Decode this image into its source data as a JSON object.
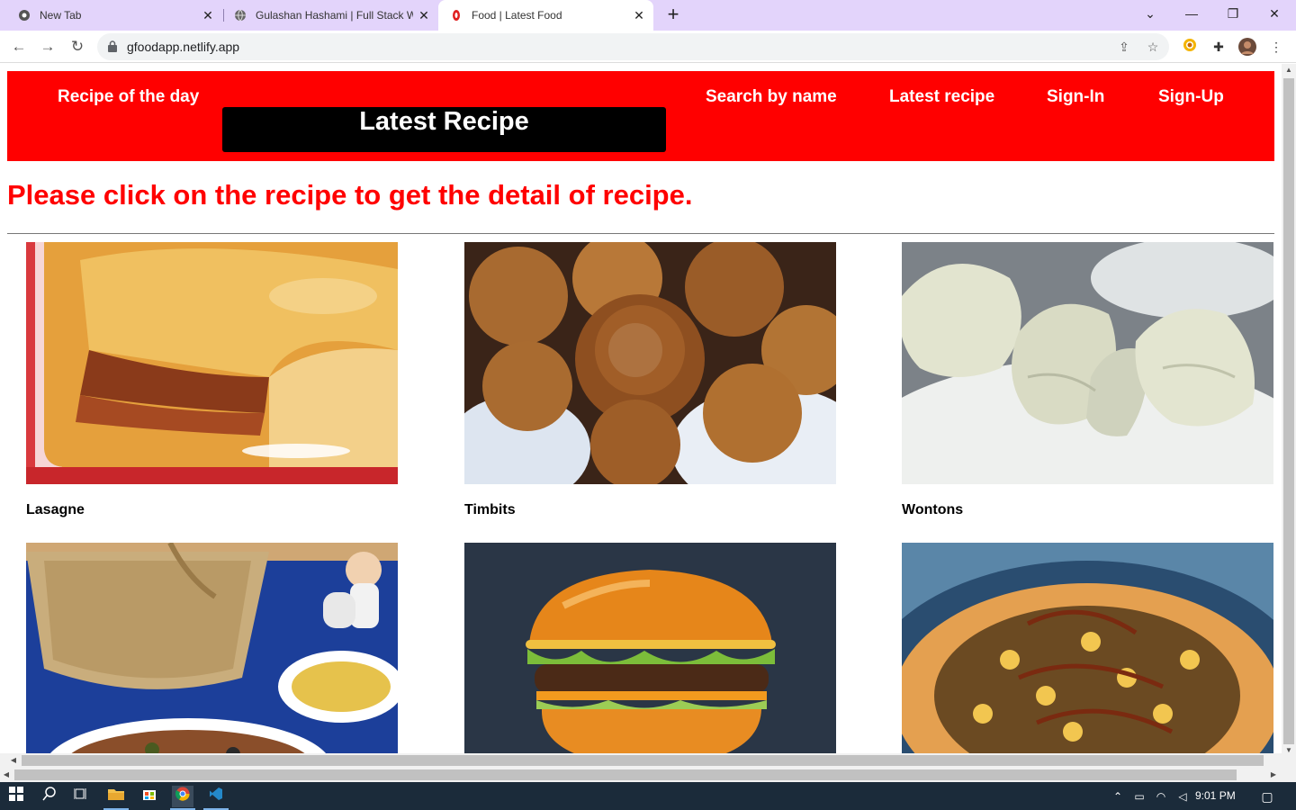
{
  "browser": {
    "tabs": [
      {
        "title": "New Tab",
        "icon": "chrome-icon"
      },
      {
        "title": "Gulashan Hashami | Full Stack We",
        "icon": "globe-icon"
      },
      {
        "title": "Food | Latest Food",
        "icon": "food-favicon"
      }
    ],
    "url": "gfoodapp.netlify.app"
  },
  "site": {
    "nav": {
      "recipe_of_day": "Recipe of the day",
      "search_by_name": "Search by name",
      "latest_recipe": "Latest recipe",
      "sign_in": "Sign-In",
      "sign_up": "Sign-Up"
    },
    "title": "Latest Recipe",
    "instruction": "Please click on the recipe to get the detail of recipe.",
    "recipes": [
      {
        "name": "Lasagne"
      },
      {
        "name": "Timbits"
      },
      {
        "name": "Wontons"
      },
      {
        "name": ""
      },
      {
        "name": ""
      },
      {
        "name": ""
      }
    ]
  },
  "taskbar": {
    "time": "9:01 PM"
  },
  "colors": {
    "header_bg": "#ff0000",
    "title_bg": "#000000",
    "instruction_text": "#ff0000",
    "tabbar_bg": "#e3d4fb"
  }
}
